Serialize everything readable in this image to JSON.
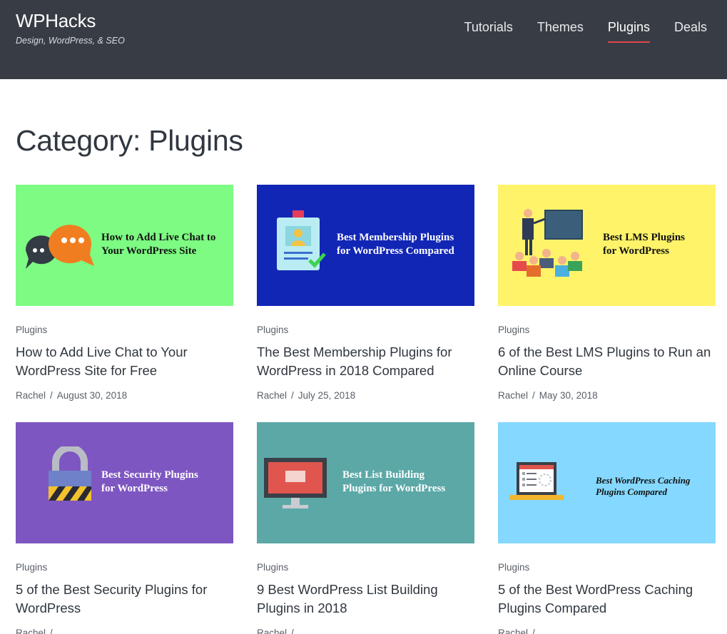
{
  "site": {
    "title": "WPHacks",
    "tagline": "Design, WordPress, & SEO"
  },
  "nav": [
    {
      "label": "Tutorials",
      "active": false
    },
    {
      "label": "Themes",
      "active": false
    },
    {
      "label": "Plugins",
      "active": true
    },
    {
      "label": "Deals",
      "active": false
    }
  ],
  "page": {
    "title": "Category: Plugins"
  },
  "colors": {
    "header_bg": "#383d45",
    "nav_active_underline": "#e0444a"
  },
  "posts": [
    {
      "category": "Plugins",
      "title": "How to Add Live Chat to Your WordPress Site for Free",
      "author": "Rachel",
      "separator": "/",
      "date": "August 30, 2018",
      "thumb": {
        "bg": "#7dfb83",
        "text": "How to Add Live Chat to\nYour WordPress Site",
        "text_color": "#111111",
        "icon": "chat-bubbles-icon"
      }
    },
    {
      "category": "Plugins",
      "title": "The Best Membership Plugins for WordPress in 2018 Compared",
      "author": "Rachel",
      "separator": "/",
      "date": "July 25, 2018",
      "thumb": {
        "bg": "#1126b5",
        "text": "Best Membership Plugins\nfor WordPress Compared",
        "text_color": "#ffffff",
        "icon": "member-badge-icon"
      }
    },
    {
      "category": "Plugins",
      "title": "6 of the Best LMS Plugins to Run an Online Course",
      "author": "Rachel",
      "separator": "/",
      "date": "May 30, 2018",
      "thumb": {
        "bg": "#fff36a",
        "text": "Best LMS Plugins\nfor WordPress",
        "text_color": "#111111",
        "icon": "classroom-icon"
      }
    },
    {
      "category": "Plugins",
      "title": "5 of the Best Security Plugins for WordPress",
      "author": "Rachel",
      "separator": "/",
      "date": "",
      "thumb": {
        "bg": "#7e56c2",
        "text": "Best Security Plugins\nfor WordPress",
        "text_color": "#ffffff",
        "icon": "padlock-icon"
      }
    },
    {
      "category": "Plugins",
      "title": "9 Best WordPress List Building Plugins in 2018",
      "author": "Rachel",
      "separator": "/",
      "date": "",
      "thumb": {
        "bg": "#5ba8a7",
        "text": "Best List Building\nPlugins for WordPress",
        "text_color": "#ffffff",
        "icon": "monitor-icon"
      }
    },
    {
      "category": "Plugins",
      "title": "5 of the Best WordPress Caching Plugins Compared",
      "author": "Rachel",
      "separator": "/",
      "date": "",
      "thumb": {
        "bg": "#85d8ff",
        "text": "Best WordPress Caching\nPlugins Compared",
        "text_color": "#111111",
        "icon": "laptop-icon"
      }
    }
  ]
}
